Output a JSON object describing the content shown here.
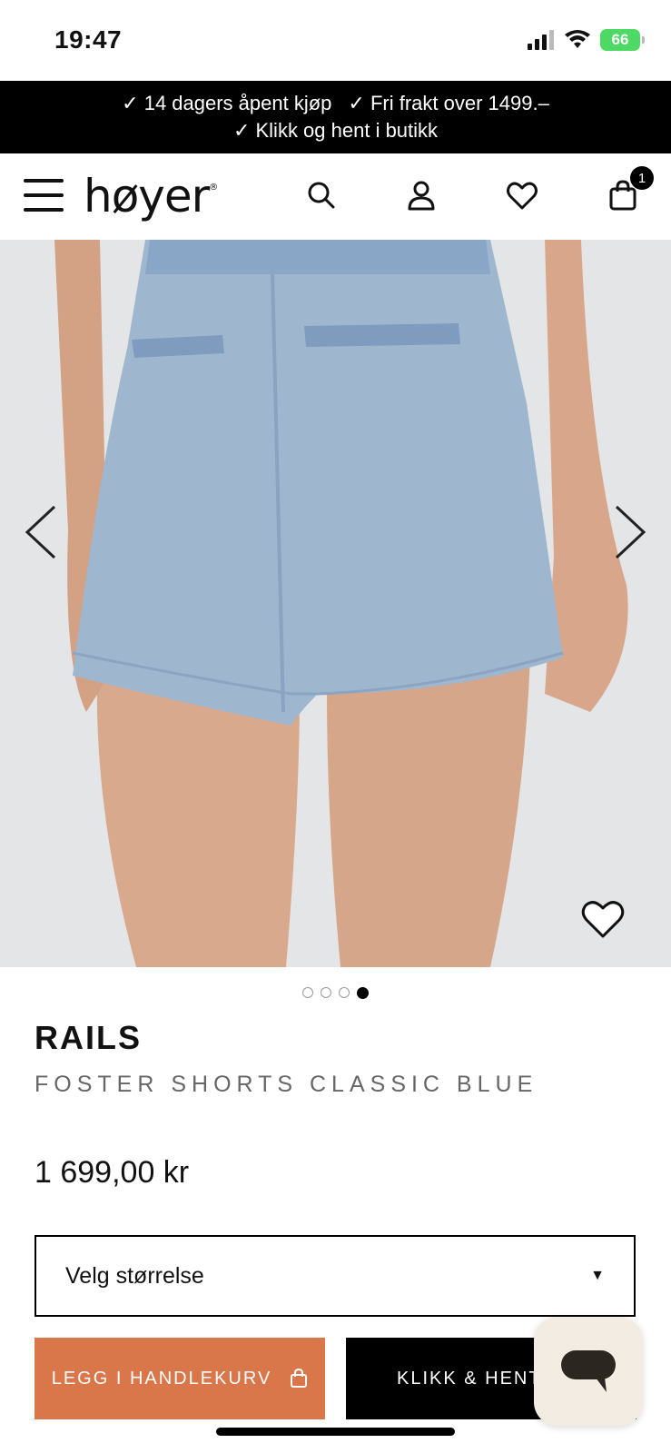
{
  "status": {
    "time": "19:47",
    "battery": "66"
  },
  "promo": {
    "line1_a": "✓ 14 dagers åpent kjøp",
    "line1_b": "✓ Fri frakt over 1499.–",
    "line2": "✓ Klikk og hent i butikk"
  },
  "header": {
    "logo": "høyer",
    "logo_mark": "®",
    "cart_count": "1"
  },
  "carousel": {
    "current_index": 4,
    "total": 4
  },
  "product": {
    "brand": "RAILS",
    "name": "FOSTER SHORTS CLASSIC BLUE",
    "price": "1 699,00 kr"
  },
  "size": {
    "placeholder": "Velg størrelse",
    "arrow": "▼"
  },
  "actions": {
    "add_to_cart": "LEGG I HANDLEKURV",
    "click_collect": "KLIKK & HENT"
  },
  "colors": {
    "promo_bg": "#000000",
    "cart_button": "#d9774a",
    "chat_bg": "#f3ece2",
    "battery": "#4cd964"
  }
}
